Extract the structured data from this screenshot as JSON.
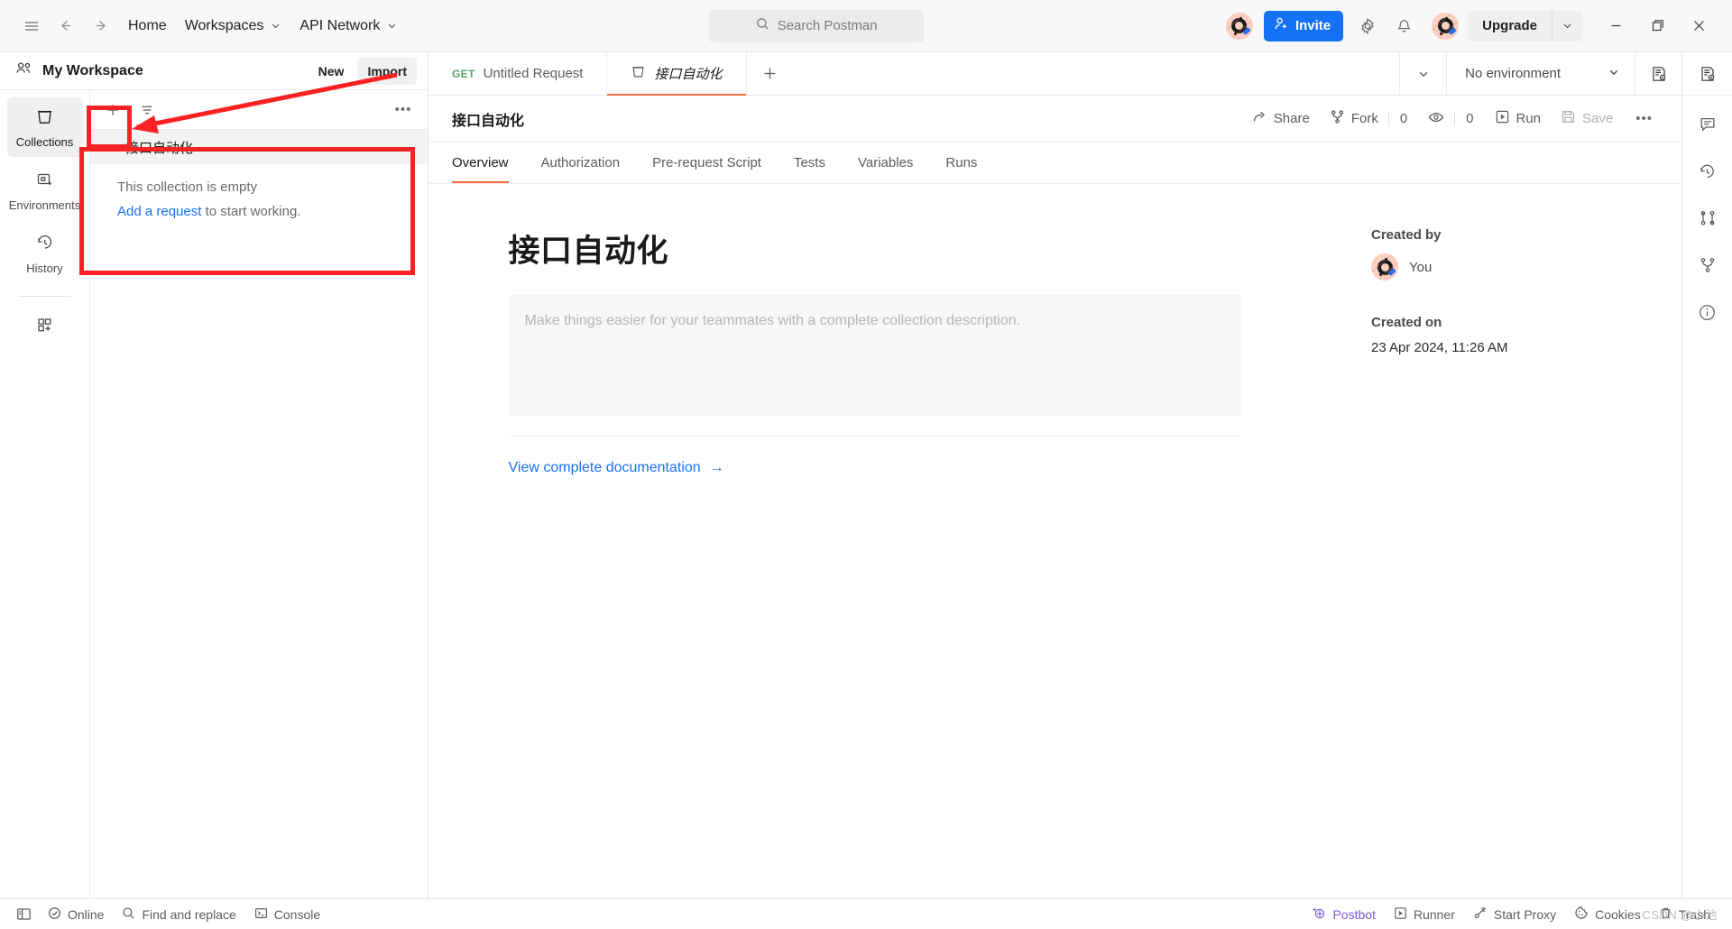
{
  "header": {
    "menu_icon": "hamburger-icon",
    "back_icon": "arrow-left-icon",
    "forward_icon": "arrow-right-icon",
    "home_label": "Home",
    "workspaces_label": "Workspaces",
    "api_network_label": "API Network",
    "search_placeholder": "Search Postman",
    "invite_label": "Invite",
    "upgrade_label": "Upgrade",
    "settings_icon": "gear-icon",
    "notifications_icon": "bell-icon",
    "account_icon": "postman-avatar-icon",
    "minimize_label": "–",
    "maximize_label": "❐",
    "close_label": "✕"
  },
  "sidebar": {
    "workspace_name": "My Workspace",
    "new_label": "New",
    "import_label": "Import",
    "rail_items": [
      {
        "label": "Collections",
        "icon": "collection-icon",
        "active": true
      },
      {
        "label": "Environments",
        "icon": "environment-icon",
        "active": false
      },
      {
        "label": "History",
        "icon": "history-icon",
        "active": false
      }
    ],
    "rail_extra_icon": "apps-add-icon",
    "toolbar": {
      "add_icon": "plus-icon",
      "filter_icon": "filter-icon",
      "more_icon": "more-horizontal-icon"
    },
    "collection": {
      "name": "接口自动化",
      "caret_icon": "chevron-down-icon",
      "empty_title": "This collection is empty",
      "empty_link": "Add a request",
      "empty_tail": "to start working."
    }
  },
  "tabs": {
    "items": [
      {
        "method": "GET",
        "label": "Untitled Request",
        "active": false,
        "icon": ""
      },
      {
        "method": "",
        "label": "接口自动化",
        "active": true,
        "icon": "collection-icon"
      }
    ],
    "add_icon": "plus-icon",
    "overflow_icon": "chevron-down-icon",
    "environment_label": "No environment",
    "environment_caret": "chevron-down-icon",
    "env_quicklook_icon": "environment-eye-icon"
  },
  "collection_header": {
    "title": "接口自动化",
    "share_label": "Share",
    "share_icon": "share-icon",
    "fork_label": "Fork",
    "fork_icon": "fork-icon",
    "fork_count": "0",
    "watch_icon": "eye-icon",
    "watch_count": "0",
    "run_label": "Run",
    "run_icon": "play-icon",
    "save_label": "Save",
    "save_icon": "save-icon",
    "more_icon": "more-horizontal-icon"
  },
  "subtabs": [
    {
      "label": "Overview",
      "active": true
    },
    {
      "label": "Authorization",
      "active": false
    },
    {
      "label": "Pre-request Script",
      "active": false
    },
    {
      "label": "Tests",
      "active": false
    },
    {
      "label": "Variables",
      "active": false
    },
    {
      "label": "Runs",
      "active": false
    }
  ],
  "overview": {
    "title": "接口自动化",
    "description_placeholder": "Make things easier for your teammates with a complete collection description.",
    "documentation_link": "View complete documentation",
    "documentation_arrow": "→"
  },
  "meta": {
    "created_by_label": "Created by",
    "created_by_value": "You",
    "created_on_label": "Created on",
    "created_on_value": "23 Apr 2024, 11:26 AM"
  },
  "right_rail": [
    {
      "icon": "environment-eye-icon",
      "name": "env-quick-look"
    },
    {
      "icon": "comment-icon",
      "name": "comments"
    },
    {
      "icon": "history-icon",
      "name": "changelog"
    },
    {
      "icon": "pull-request-icon",
      "name": "pull-requests"
    },
    {
      "icon": "fork-icon",
      "name": "forks"
    },
    {
      "icon": "info-icon",
      "name": "documentation-info"
    }
  ],
  "statusbar": {
    "sidebar_toggle_icon": "panel-toggle-icon",
    "online_label": "Online",
    "online_icon": "check-circle-icon",
    "find_label": "Find and replace",
    "find_icon": "search-icon",
    "console_label": "Console",
    "console_icon": "terminal-icon",
    "postbot_label": "Postbot",
    "postbot_icon": "sparkle-bot-icon",
    "runner_label": "Runner",
    "runner_icon": "play-icon",
    "proxy_label": "Start Proxy",
    "proxy_icon": "proxy-icon",
    "cookies_label": "Cookies",
    "cookies_icon": "cookie-icon",
    "trash_label": "Trash",
    "trash_icon": "trash-icon",
    "watermark": "CSDN @小池"
  },
  "colors": {
    "accent_orange": "#f26b3a",
    "link_blue": "#1572f7",
    "annotation_red": "#fa2222",
    "method_get_green": "#5aa469"
  }
}
